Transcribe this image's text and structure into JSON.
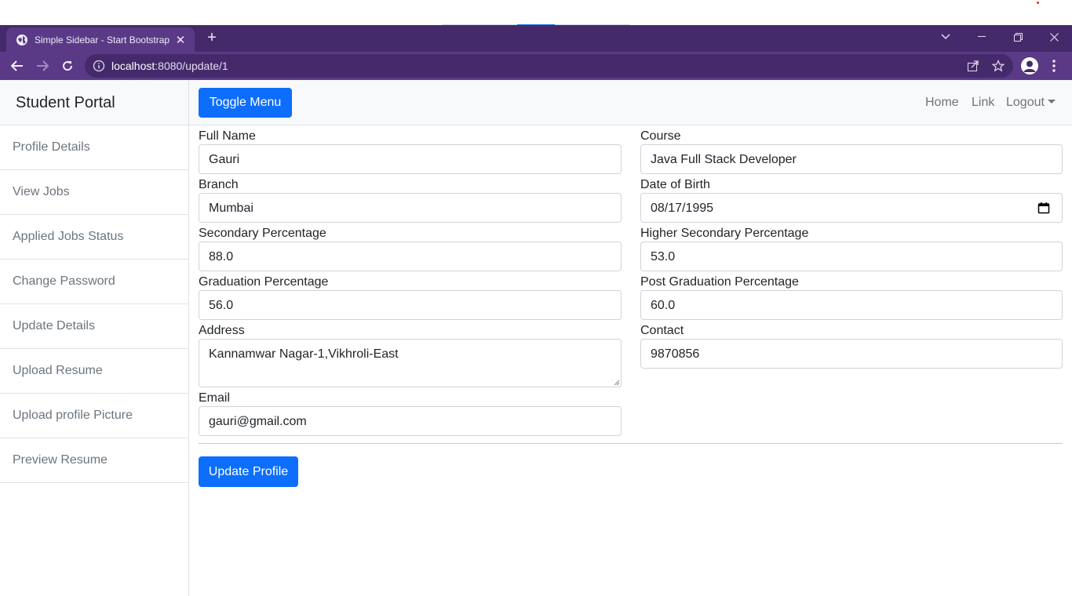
{
  "browser": {
    "tab_title": "Simple Sidebar - Start Bootstrap",
    "url_host": "localhost",
    "url_path": ":8080/update/1"
  },
  "sidebar": {
    "heading": "Student Portal",
    "items": [
      {
        "label": "Profile Details"
      },
      {
        "label": "View Jobs"
      },
      {
        "label": "Applied Jobs Status"
      },
      {
        "label": "Change Password"
      },
      {
        "label": "Update Details"
      },
      {
        "label": "Upload Resume"
      },
      {
        "label": "Upload profile Picture"
      },
      {
        "label": "Preview Resume"
      }
    ]
  },
  "topnav": {
    "toggle_label": "Toggle Menu",
    "home": "Home",
    "link": "Link",
    "logout": "Logout"
  },
  "form": {
    "full_name": {
      "label": "Full Name",
      "value": "Gauri"
    },
    "course": {
      "label": "Course",
      "value": "Java Full Stack Developer"
    },
    "branch": {
      "label": "Branch",
      "value": "Mumbai"
    },
    "dob": {
      "label": "Date of Birth",
      "value": "08/17/1995"
    },
    "secondary": {
      "label": "Secondary Percentage",
      "value": "88.0"
    },
    "higher_secondary": {
      "label": "Higher Secondary Percentage",
      "value": "53.0"
    },
    "graduation": {
      "label": "Graduation Percentage",
      "value": "56.0"
    },
    "post_graduation": {
      "label": "Post Graduation Percentage",
      "value": "60.0"
    },
    "address": {
      "label": "Address",
      "value": "Kannamwar Nagar-1,Vikhroli-East"
    },
    "contact": {
      "label": "Contact",
      "value": "9870856"
    },
    "email": {
      "label": "Email",
      "value": "gauri@gmail.com"
    },
    "submit_label": "Update Profile"
  },
  "colors": {
    "primary": "#0d6efd",
    "browser_frame": "#452a6b",
    "browser_toolbar": "#5a3a86"
  }
}
